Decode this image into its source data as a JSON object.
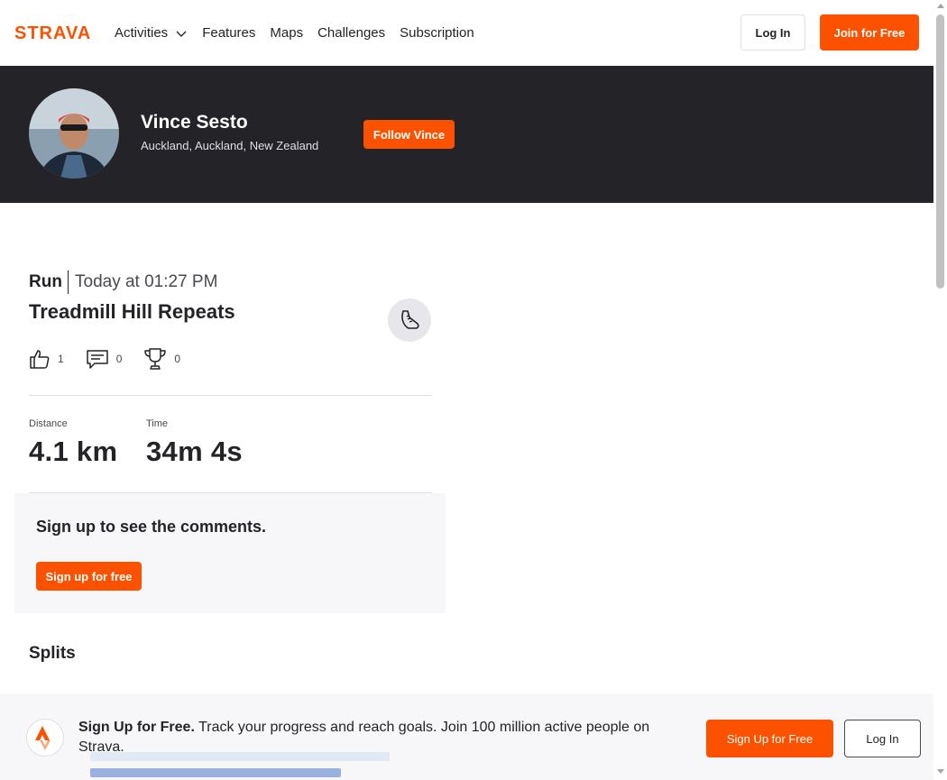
{
  "nav": {
    "logo_text": "STRAVA",
    "brand_color": "#fc5200",
    "items": [
      {
        "label": "Activities",
        "has_dropdown": true
      },
      {
        "label": "Features"
      },
      {
        "label": "Maps"
      },
      {
        "label": "Challenges"
      },
      {
        "label": "Subscription"
      }
    ],
    "login_label": "Log In",
    "join_label": "Join for Free"
  },
  "athlete": {
    "name": "Vince Sesto",
    "location": "Auckland, Auckland, New Zealand",
    "follow_label": "Follow Vince"
  },
  "activity": {
    "type": "Run",
    "time": "Today at 01:27 PM",
    "title": "Treadmill Hill Repeats",
    "sport_icon": "running-shoe-icon",
    "kudos": "1",
    "comments": "0",
    "achievements": "0",
    "stats": [
      {
        "label": "Distance",
        "value": "4.1 km"
      },
      {
        "label": "Time",
        "value": "34m 4s"
      }
    ]
  },
  "comments_signup": {
    "title": "Sign up to see the comments.",
    "button_label": "Sign up for free"
  },
  "splits": {
    "title": "Splits"
  },
  "bottom_banner": {
    "headline": "Sign Up for Free.",
    "body": "Track your progress and reach goals. Join 100 million active people on Strava.",
    "signup_label": "Sign Up for Free",
    "login_label": "Log In"
  }
}
